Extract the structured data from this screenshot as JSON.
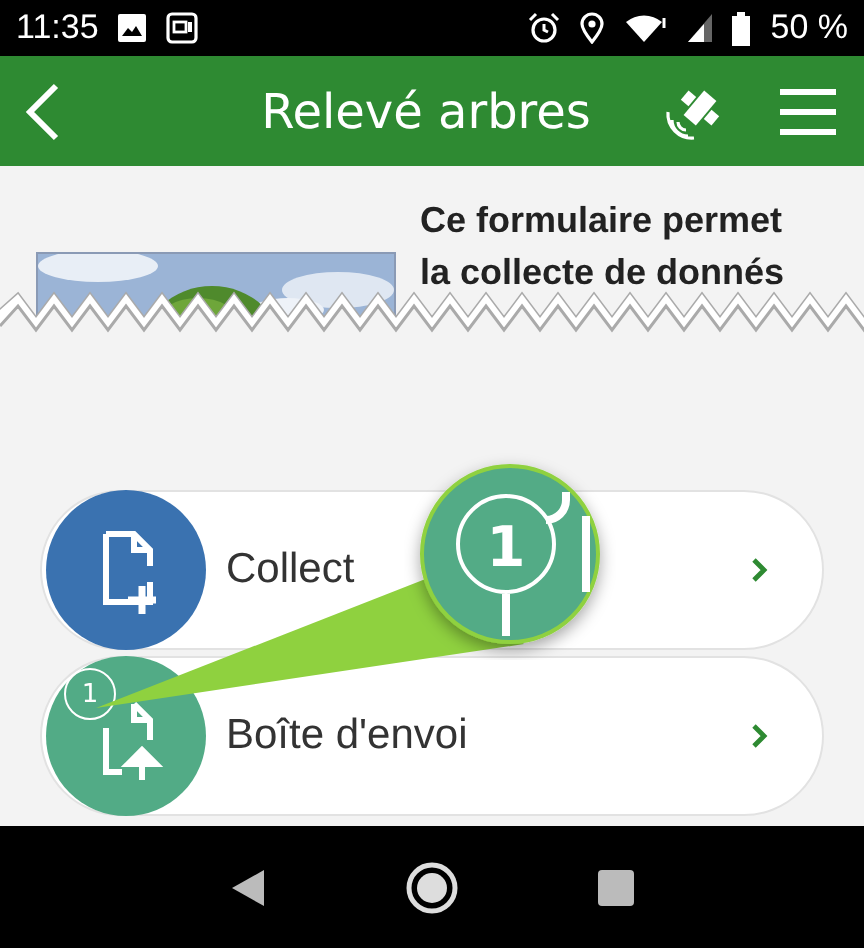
{
  "status_bar": {
    "time": "11:35",
    "battery_text": "50 %"
  },
  "app_bar": {
    "title": "Relevé arbres"
  },
  "form_header": {
    "description": "Ce formulaire permet la collecte de donnés"
  },
  "actions": [
    {
      "kind": "collect",
      "label": "Collect"
    },
    {
      "kind": "outbox",
      "label": "Boîte d'envoi",
      "badge": "1"
    }
  ],
  "magnifier": {
    "badge": "1"
  }
}
